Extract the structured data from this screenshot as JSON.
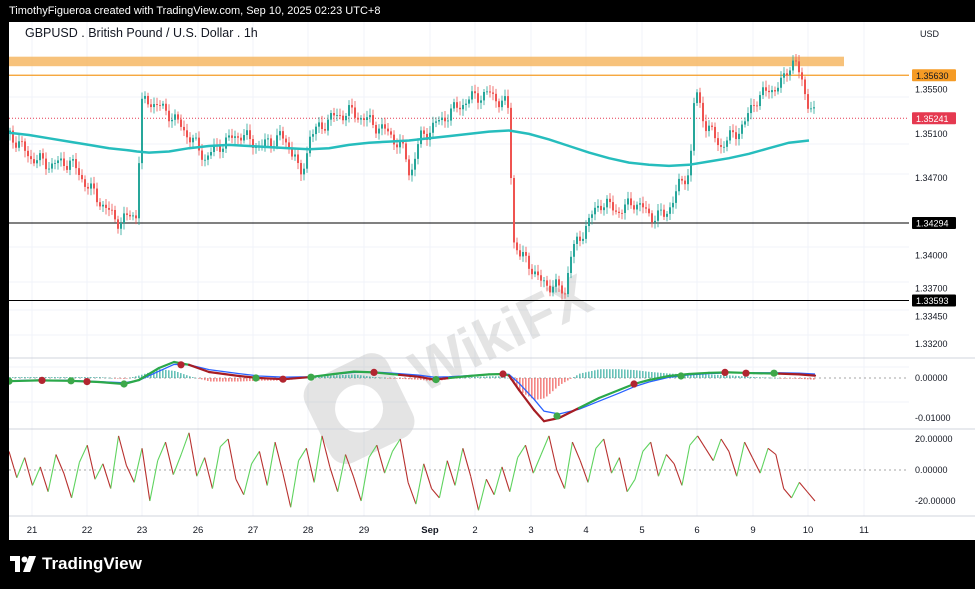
{
  "header_text": "TimothyFigueroa created with TradingView.com, Sep 10, 2025 02:23 UTC+8",
  "footer": {
    "brand": "TradingView"
  },
  "watermark": "WikiFX",
  "colors": {
    "up": "#26a69a",
    "down": "#ef5350",
    "ema": "#26bdbd",
    "resistance_band": "#f5b35a",
    "level_orange": "#f59b25",
    "current": "#e53950",
    "black_level": "#000000",
    "macd_fast": "#2ba84a",
    "macd_slow": "#a61d24",
    "macd_signal": "#2962ff",
    "rsi_up": "#5fd35f",
    "rsi_down": "#b8312f"
  },
  "chart_data": [
    {
      "type": "candlestick",
      "title": "GBPUSD . British Pound / U.S. Dollar . 1h",
      "currency": "USD",
      "ylim": [
        1.33,
        1.3575
      ],
      "y_ticks": [
        "1.35500",
        "1.35100",
        "1.34700",
        "1.34000",
        "1.33700",
        "1.33450",
        "1.33200"
      ],
      "x_ticks": [
        "21",
        "22",
        "23",
        "26",
        "27",
        "28",
        "29",
        "Sep",
        "2",
        "3",
        "4",
        "5",
        "6",
        "9",
        "10",
        "11"
      ],
      "levels": [
        {
          "label": "1.35630",
          "value": 1.3563,
          "color": "orange"
        },
        {
          "label": "1.35241",
          "value": 1.35241,
          "color": "red",
          "current": true
        },
        {
          "label": "1.34294",
          "value": 1.34294,
          "color": "black"
        },
        {
          "label": "1.33593",
          "value": 1.33593,
          "color": "black"
        }
      ],
      "resistance_zone": [
        1.3573,
        1.3578
      ],
      "ema_path": [
        [
          0,
          1.3511
        ],
        [
          20,
          1.3509
        ],
        [
          40,
          1.3506
        ],
        [
          60,
          1.3503
        ],
        [
          80,
          1.35
        ],
        [
          100,
          1.3497
        ],
        [
          120,
          1.3495
        ],
        [
          128,
          1.3494
        ],
        [
          140,
          1.3493
        ],
        [
          160,
          1.3494
        ],
        [
          180,
          1.3497
        ],
        [
          200,
          1.3499
        ],
        [
          220,
          1.35
        ],
        [
          240,
          1.3499
        ],
        [
          260,
          1.3498
        ],
        [
          280,
          1.3497
        ],
        [
          300,
          1.3496
        ],
        [
          320,
          1.3497
        ],
        [
          340,
          1.35
        ],
        [
          360,
          1.3502
        ],
        [
          380,
          1.3503
        ],
        [
          400,
          1.3504
        ],
        [
          420,
          1.3506
        ],
        [
          440,
          1.3508
        ],
        [
          460,
          1.351
        ],
        [
          480,
          1.3512
        ],
        [
          500,
          1.3513
        ],
        [
          520,
          1.351
        ],
        [
          540,
          1.3505
        ],
        [
          560,
          1.3499
        ],
        [
          580,
          1.3493
        ],
        [
          600,
          1.3488
        ],
        [
          620,
          1.3484
        ],
        [
          640,
          1.3482
        ],
        [
          660,
          1.3481
        ],
        [
          680,
          1.3482
        ],
        [
          700,
          1.3485
        ],
        [
          720,
          1.3488
        ],
        [
          740,
          1.3492
        ],
        [
          760,
          1.3497
        ],
        [
          780,
          1.3502
        ],
        [
          800,
          1.3504
        ]
      ],
      "price_path": [
        [
          0,
          1.351
        ],
        [
          20,
          1.3489
        ],
        [
          40,
          1.3482
        ],
        [
          60,
          1.3485
        ],
        [
          80,
          1.346
        ],
        [
          100,
          1.3438
        ],
        [
          110,
          1.343
        ],
        [
          120,
          1.3436
        ],
        [
          128,
          1.3438
        ],
        [
          130,
          1.3536
        ],
        [
          140,
          1.354
        ],
        [
          160,
          1.3528
        ],
        [
          180,
          1.3507
        ],
        [
          195,
          1.3488
        ],
        [
          210,
          1.35
        ],
        [
          230,
          1.351
        ],
        [
          250,
          1.3498
        ],
        [
          270,
          1.3508
        ],
        [
          285,
          1.3492
        ],
        [
          290,
          1.3466
        ],
        [
          300,
          1.3508
        ],
        [
          320,
          1.3524
        ],
        [
          340,
          1.353
        ],
        [
          360,
          1.3521
        ],
        [
          380,
          1.351
        ],
        [
          395,
          1.3493
        ],
        [
          400,
          1.3472
        ],
        [
          410,
          1.3506
        ],
        [
          430,
          1.3522
        ],
        [
          450,
          1.3536
        ],
        [
          465,
          1.3544
        ],
        [
          480,
          1.3546
        ],
        [
          495,
          1.3537
        ],
        [
          500,
          1.3529
        ],
        [
          502,
          1.3418
        ],
        [
          510,
          1.34
        ],
        [
          520,
          1.3392
        ],
        [
          530,
          1.3376
        ],
        [
          545,
          1.3372
        ],
        [
          555,
          1.3367
        ],
        [
          560,
          1.3399
        ],
        [
          575,
          1.3425
        ],
        [
          590,
          1.3448
        ],
        [
          610,
          1.344
        ],
        [
          625,
          1.3449
        ],
        [
          640,
          1.3436
        ],
        [
          655,
          1.3436
        ],
        [
          670,
          1.3464
        ],
        [
          680,
          1.3478
        ],
        [
          685,
          1.3551
        ],
        [
          695,
          1.352
        ],
        [
          710,
          1.3499
        ],
        [
          725,
          1.351
        ],
        [
          735,
          1.352
        ],
        [
          745,
          1.3541
        ],
        [
          760,
          1.355
        ],
        [
          772,
          1.3555
        ],
        [
          778,
          1.357
        ],
        [
          785,
          1.3578
        ],
        [
          790,
          1.356
        ],
        [
          798,
          1.354
        ],
        [
          806,
          1.3524
        ]
      ]
    },
    {
      "type": "macd",
      "y_ticks": [
        "0.00000",
        "-0.01000"
      ],
      "fast_path": [
        [
          0,
          -0.0008
        ],
        [
          30,
          -0.0006
        ],
        [
          60,
          -0.0007
        ],
        [
          90,
          -0.001
        ],
        [
          115,
          -0.0015
        ],
        [
          130,
          -0.0005
        ],
        [
          150,
          0.0025
        ],
        [
          165,
          0.004
        ],
        [
          180,
          0.0033
        ],
        [
          200,
          0.0015
        ],
        [
          230,
          0.0005
        ],
        [
          250,
          0.0
        ],
        [
          275,
          -0.0003
        ],
        [
          300,
          0.0002
        ],
        [
          325,
          0.001
        ],
        [
          345,
          0.0016
        ],
        [
          365,
          0.0014
        ],
        [
          390,
          0.0008
        ],
        [
          410,
          0.0003
        ],
        [
          425,
          -0.0004
        ],
        [
          440,
          0.0
        ],
        [
          460,
          0.0005
        ],
        [
          480,
          0.0009
        ],
        [
          495,
          0.001
        ],
        [
          500,
          0.0006
        ],
        [
          510,
          -0.003
        ],
        [
          525,
          -0.008
        ],
        [
          535,
          -0.0108
        ],
        [
          550,
          -0.01
        ],
        [
          570,
          -0.0075
        ],
        [
          590,
          -0.005
        ],
        [
          610,
          -0.003
        ],
        [
          625,
          -0.0015
        ],
        [
          640,
          -0.0005
        ],
        [
          660,
          0.0005
        ],
        [
          680,
          0.001
        ],
        [
          700,
          0.0013
        ],
        [
          720,
          0.0014
        ],
        [
          745,
          0.0012
        ],
        [
          770,
          0.0011
        ],
        [
          790,
          0.0009
        ],
        [
          806,
          0.0006
        ]
      ],
      "slow_path": [
        [
          0,
          -0.0009
        ],
        [
          30,
          -0.0007
        ],
        [
          60,
          -0.0008
        ],
        [
          90,
          -0.0011
        ],
        [
          115,
          -0.0014
        ],
        [
          130,
          -0.0008
        ],
        [
          150,
          0.0015
        ],
        [
          165,
          0.0032
        ],
        [
          180,
          0.0031
        ],
        [
          200,
          0.0019
        ],
        [
          230,
          0.0009
        ],
        [
          250,
          0.0003
        ],
        [
          275,
          0.0
        ],
        [
          300,
          0.0001
        ],
        [
          325,
          0.0007
        ],
        [
          345,
          0.0012
        ],
        [
          365,
          0.0013
        ],
        [
          390,
          0.0009
        ],
        [
          410,
          0.0005
        ],
        [
          425,
          0.0
        ],
        [
          440,
          0.0001
        ],
        [
          460,
          0.0004
        ],
        [
          480,
          0.0007
        ],
        [
          495,
          0.0008
        ],
        [
          500,
          0.0007
        ],
        [
          510,
          -0.0015
        ],
        [
          525,
          -0.0055
        ],
        [
          535,
          -0.0085
        ],
        [
          550,
          -0.0092
        ],
        [
          570,
          -0.008
        ],
        [
          590,
          -0.006
        ],
        [
          610,
          -0.004
        ],
        [
          625,
          -0.0024
        ],
        [
          640,
          -0.0012
        ],
        [
          660,
          0.0
        ],
        [
          680,
          0.0006
        ],
        [
          700,
          0.0009
        ],
        [
          720,
          0.0011
        ],
        [
          745,
          0.0011
        ],
        [
          770,
          0.0011
        ],
        [
          790,
          0.001
        ],
        [
          806,
          0.0008
        ]
      ],
      "dots": [
        [
          0,
          -0.0008,
          "g"
        ],
        [
          33,
          -0.0006,
          "r"
        ],
        [
          62,
          -0.0007,
          "g"
        ],
        [
          78,
          -0.0009,
          "r"
        ],
        [
          115,
          -0.0015,
          "g"
        ],
        [
          172,
          0.0033,
          "r"
        ],
        [
          247,
          0.0,
          "g"
        ],
        [
          274,
          -0.0003,
          "r"
        ],
        [
          302,
          0.0002,
          "g"
        ],
        [
          365,
          0.0014,
          "r"
        ],
        [
          427,
          -0.0004,
          "g"
        ],
        [
          494,
          0.001,
          "r"
        ],
        [
          548,
          -0.0095,
          "g"
        ],
        [
          625,
          -0.0015,
          "r"
        ],
        [
          672,
          0.0005,
          "g"
        ],
        [
          716,
          0.0014,
          "r"
        ],
        [
          737,
          0.0012,
          "r"
        ],
        [
          765,
          0.0012,
          "g"
        ]
      ]
    },
    {
      "type": "line",
      "name": "oscillator",
      "y_ticks": [
        "20.00000",
        "0.00000",
        "-20.00000"
      ],
      "ylim": [
        -30,
        30
      ],
      "values": [
        12,
        -5,
        8,
        -10,
        2,
        -14,
        10,
        -2,
        -18,
        5,
        16,
        -6,
        4,
        -12,
        22,
        3,
        -8,
        14,
        -20,
        6,
        18,
        -3,
        10,
        24,
        -4,
        8,
        -12,
        15,
        20,
        -6,
        -16,
        4,
        12,
        -10,
        18,
        -2,
        -24,
        6,
        14,
        -8,
        22,
        2,
        -14,
        10,
        -4,
        -20,
        8,
        16,
        -2,
        12,
        20,
        -8,
        -22,
        4,
        -12,
        -18,
        6,
        -10,
        14,
        -4,
        -26,
        -6,
        -16,
        2,
        -14,
        8,
        16,
        -2,
        10,
        22,
        0,
        -12,
        18,
        6,
        -8,
        14,
        20,
        -2,
        8,
        -14,
        -6,
        12,
        18,
        -4,
        10,
        4,
        -10,
        16,
        22,
        14,
        6,
        20,
        12,
        -4,
        18,
        8,
        -2,
        14,
        10,
        -12,
        -18,
        -8,
        -14,
        -20
      ]
    }
  ]
}
